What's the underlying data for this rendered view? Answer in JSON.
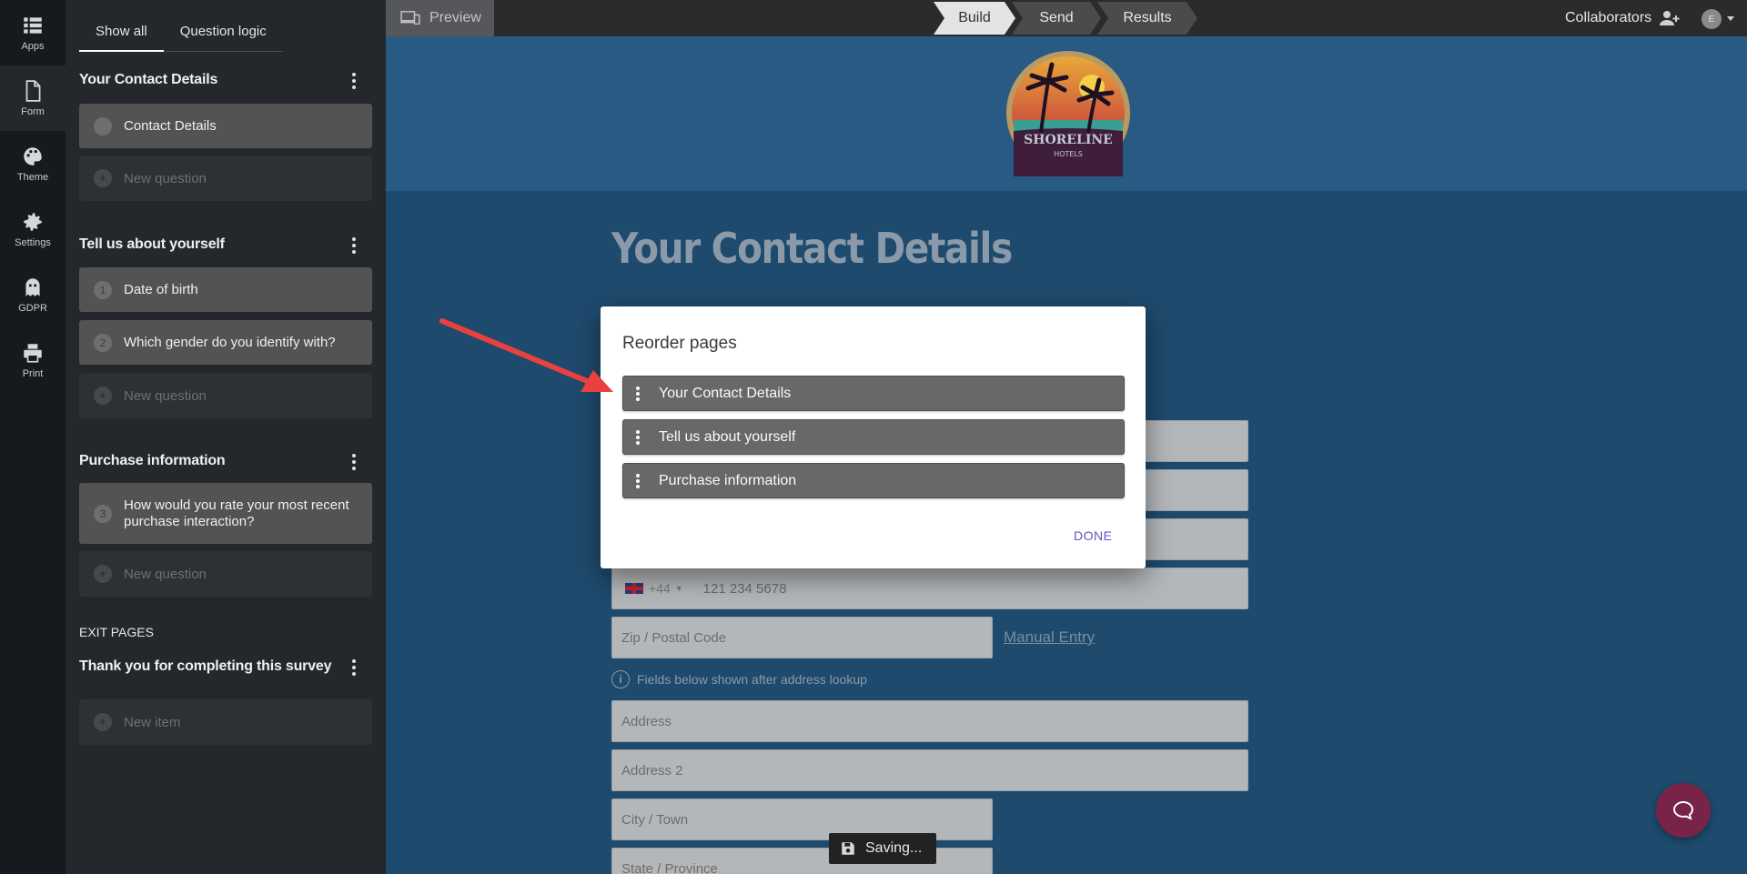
{
  "rail": {
    "items": [
      {
        "label": "Apps",
        "icon": "apps-icon"
      },
      {
        "label": "Form",
        "icon": "form-icon"
      },
      {
        "label": "Theme",
        "icon": "palette-icon"
      },
      {
        "label": "Settings",
        "icon": "gear-icon"
      },
      {
        "label": "GDPR",
        "icon": "ghost-icon"
      },
      {
        "label": "Print",
        "icon": "printer-icon"
      }
    ]
  },
  "sidebar": {
    "tabs": [
      "Show all",
      "Question logic"
    ],
    "sections": [
      {
        "title": "Your Contact Details",
        "items": [
          {
            "num": "",
            "label": "Contact Details"
          }
        ],
        "new_label": "New question"
      },
      {
        "title": "Tell us about yourself",
        "items": [
          {
            "num": "1",
            "label": "Date of birth"
          },
          {
            "num": "2",
            "label": "Which gender do you identify with?"
          }
        ],
        "new_label": "New question"
      },
      {
        "title": "Purchase information",
        "items": [
          {
            "num": "3",
            "label": "How would you rate your most recent purchase interaction?"
          }
        ],
        "new_label": "New question"
      }
    ],
    "exit_label": "EXIT PAGES",
    "exit_title": "Thank you for completing this survey",
    "exit_new_label": "New item"
  },
  "topbar": {
    "preview_label": "Preview",
    "steps": [
      "Build",
      "Send",
      "Results"
    ],
    "active_step": "Build",
    "collaborators_label": "Collaborators",
    "avatar_initial": "E"
  },
  "canvas": {
    "logo_text": "SHORELINE",
    "logo_subtext": "HOTELS",
    "form_title": "Your Contact Details",
    "phone_code": "+44",
    "phone_placeholder": "121 234 5678",
    "zip_placeholder": "Zip / Postal Code",
    "manual_entry": "Manual Entry",
    "info_text": "Fields below shown after address lookup",
    "address_placeholder": "Address",
    "address2_placeholder": "Address 2",
    "city_placeholder": "City / Town",
    "state_placeholder": "State / Province"
  },
  "modal": {
    "title": "Reorder pages",
    "pages": [
      "Your Contact Details",
      "Tell us about yourself",
      "Purchase information"
    ],
    "done_label": "DONE"
  },
  "toast": {
    "label": "Saving..."
  },
  "colors": {
    "canvas_bg": "#1e4a6d",
    "header_band": "#285a84",
    "sidebar_bg": "#24272c",
    "rail_bg": "#16191d",
    "accent": "#6a4fc8",
    "arrow": "#e8413f",
    "chat": "#7a2349"
  }
}
